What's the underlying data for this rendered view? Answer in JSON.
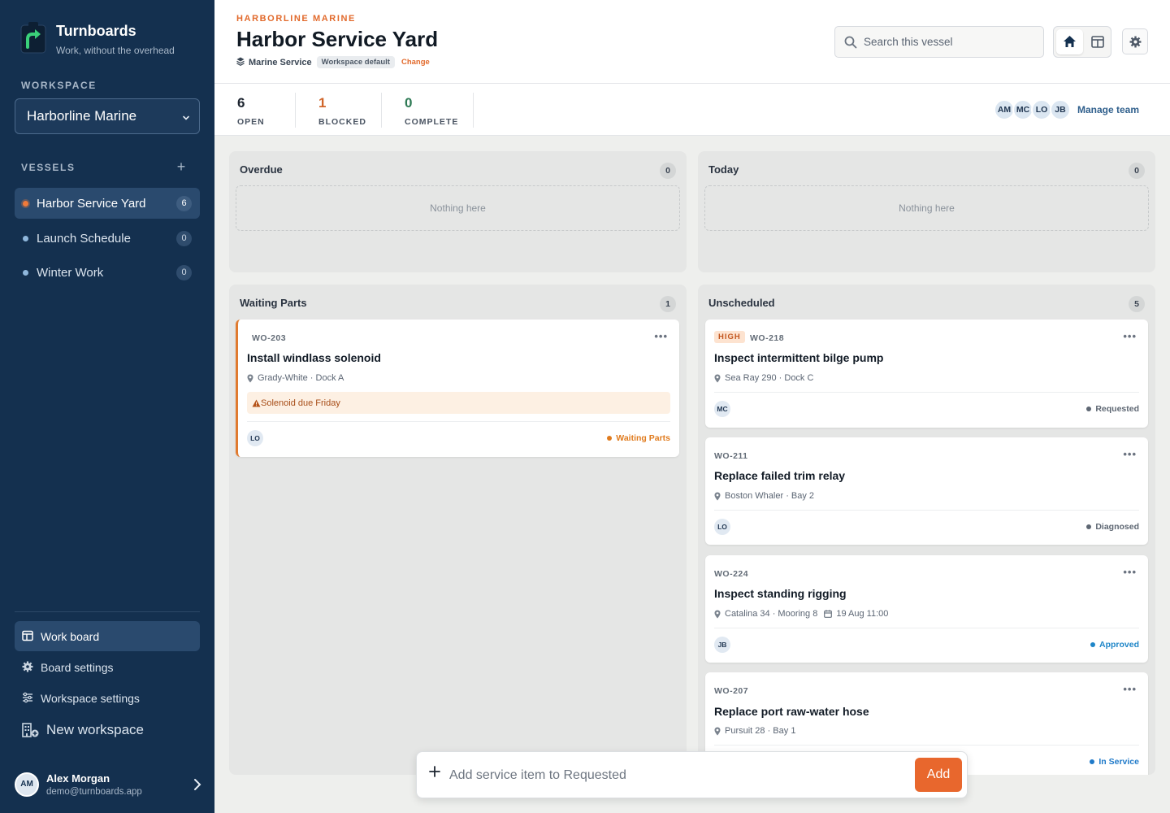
{
  "app": {
    "name": "Turnboards",
    "tagline": "Work, without the overhead"
  },
  "sidebar": {
    "workspace_label": "WORKSPACE",
    "workspace_selected": "Harborline Marine",
    "vessels_label": "VESSELS",
    "vessels": [
      {
        "name": "Harbor Service Yard",
        "count": "6",
        "active": true
      },
      {
        "name": "Launch Schedule",
        "count": "0",
        "active": false
      },
      {
        "name": "Winter Work",
        "count": "0",
        "active": false
      }
    ],
    "nav": [
      {
        "label": "Work board",
        "icon": "board-icon",
        "active": true
      },
      {
        "label": "Board settings",
        "icon": "gear-icon",
        "active": false
      },
      {
        "label": "Workspace settings",
        "icon": "sliders-icon",
        "active": false
      },
      {
        "label": "New workspace",
        "icon": "building-add-icon",
        "active": false
      }
    ],
    "user": {
      "initials": "AM",
      "name": "Alex Morgan",
      "email": "demo@turnboards.app"
    }
  },
  "header": {
    "kicker": "HARBORLINE MARINE",
    "title": "Harbor Service Yard",
    "service": "Marine Service",
    "tag": "Workspace default",
    "change": "Change",
    "search_placeholder": "Search this vessel"
  },
  "stats": [
    {
      "value": "6",
      "label": "OPEN",
      "color": "#1d2530"
    },
    {
      "value": "1",
      "label": "BLOCKED",
      "color": "#d0652a"
    },
    {
      "value": "0",
      "label": "COMPLETE",
      "color": "#2e7a55"
    }
  ],
  "team": {
    "members": [
      "AM",
      "MC",
      "LO",
      "JB"
    ],
    "manage_label": "Manage team"
  },
  "columns": {
    "overdue": {
      "title": "Overdue",
      "count": "0",
      "empty": "Nothing here"
    },
    "today": {
      "title": "Today",
      "count": "0",
      "empty": "Nothing here"
    },
    "waiting": {
      "title": "Waiting Parts",
      "count": "1",
      "cards": [
        {
          "code": "WO-203",
          "title": "Install windlass solenoid",
          "location": "Grady-White · Dock A",
          "warning": "Solenoid due Friday",
          "assignee": "LO",
          "status": "Waiting Parts",
          "status_color": "#e07b1e"
        }
      ]
    },
    "unscheduled": {
      "title": "Unscheduled",
      "count": "5",
      "cards": [
        {
          "priority": "HIGH",
          "code": "WO-218",
          "title": "Inspect intermittent bilge pump",
          "location": "Sea Ray 290 · Dock C",
          "assignee": "MC",
          "status": "Requested",
          "status_color": "#5e6773"
        },
        {
          "code": "WO-211",
          "title": "Replace failed trim relay",
          "location": "Boston Whaler · Bay 2",
          "assignee": "LO",
          "status": "Diagnosed",
          "status_color": "#5e6773"
        },
        {
          "code": "WO-224",
          "title": "Inspect standing rigging",
          "location": "Catalina 34 · Mooring 8",
          "due": "19 Aug 11:00",
          "assignee": "JB",
          "status": "Approved",
          "status_color": "#1f86c8"
        },
        {
          "code": "WO-207",
          "title": "Replace port raw-water hose",
          "location": "Pursuit 28 · Bay 1",
          "status": "In Service",
          "status_color": "#1f7ac9"
        }
      ]
    }
  },
  "add_bar": {
    "placeholder": "Add service item to Requested",
    "button": "Add"
  }
}
